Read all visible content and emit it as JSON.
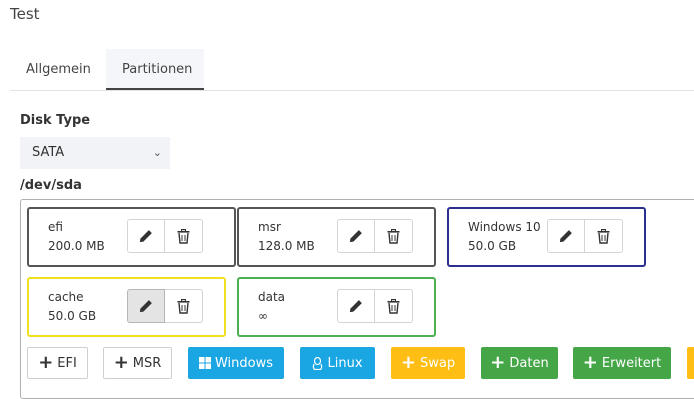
{
  "dialog": {
    "title": "Test"
  },
  "tabs": [
    {
      "label": "Allgemein",
      "active": false
    },
    {
      "label": "Partitionen",
      "active": true
    }
  ],
  "disk_type": {
    "label": "Disk Type",
    "value": "SATA"
  },
  "device": {
    "label": "/dev/sda"
  },
  "partitions": [
    {
      "name": "efi",
      "size": "200.0 MB",
      "border_color": "#555555"
    },
    {
      "name": "msr",
      "size": "128.0 MB",
      "border_color": "#555555"
    },
    {
      "name": "Windows 10",
      "size": "50.0 GB",
      "border_color": "#2b2f8f"
    },
    {
      "name": "cache",
      "size": "50.0 GB",
      "border_color": "#f0e020"
    },
    {
      "name": "data",
      "size": "∞",
      "border_color": "#4caf50"
    }
  ],
  "actions": [
    {
      "label": "EFI",
      "icon": "plus-icon",
      "bg": "#ffffff",
      "fg": "#333333"
    },
    {
      "label": "MSR",
      "icon": "plus-icon",
      "bg": "#ffffff",
      "fg": "#333333"
    },
    {
      "label": "Windows",
      "icon": "windows-icon",
      "bg": "#1aa6e3",
      "fg": "#ffffff"
    },
    {
      "label": "Linux",
      "icon": "linux-icon",
      "bg": "#1aa6e3",
      "fg": "#ffffff"
    },
    {
      "label": "Swap",
      "icon": "plus-icon",
      "bg": "#ffbe14",
      "fg": "#ffffff"
    },
    {
      "label": "Daten",
      "icon": "plus-icon",
      "bg": "#45a648",
      "fg": "#ffffff"
    },
    {
      "label": "Erweitert",
      "icon": "plus-icon",
      "bg": "#45a648",
      "fg": "#ffffff"
    }
  ]
}
